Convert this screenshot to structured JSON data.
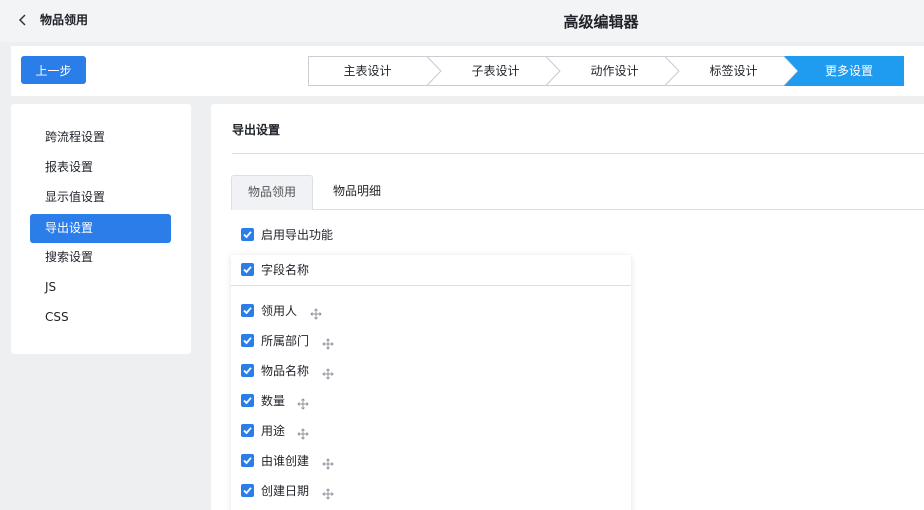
{
  "header": {
    "back_label": "物品领用",
    "title": "高级编辑器"
  },
  "toolbar": {
    "prev_label": "上一步",
    "steps": [
      {
        "label": "主表设计",
        "active": false
      },
      {
        "label": "子表设计",
        "active": false
      },
      {
        "label": "动作设计",
        "active": false
      },
      {
        "label": "标签设计",
        "active": false
      },
      {
        "label": "更多设置",
        "active": true
      }
    ]
  },
  "sidebar": {
    "items": [
      {
        "label": "跨流程设置",
        "active": false
      },
      {
        "label": "报表设置",
        "active": false
      },
      {
        "label": "显示值设置",
        "active": false
      },
      {
        "label": "导出设置",
        "active": true
      },
      {
        "label": "搜索设置",
        "active": false
      },
      {
        "label": "JS",
        "active": false
      },
      {
        "label": "CSS",
        "active": false
      }
    ]
  },
  "main": {
    "section_title": "导出设置",
    "tabs": [
      {
        "label": "物品领用",
        "active": true
      },
      {
        "label": "物品明细",
        "active": false
      }
    ],
    "enable_export": {
      "label": "启用导出功能",
      "checked": true
    },
    "field_header": {
      "label": "字段名称",
      "checked": true
    },
    "fields": [
      {
        "label": "领用人",
        "checked": true
      },
      {
        "label": "所属部门",
        "checked": true
      },
      {
        "label": "物品名称",
        "checked": true
      },
      {
        "label": "数量",
        "checked": true
      },
      {
        "label": "用途",
        "checked": true
      },
      {
        "label": "由谁创建",
        "checked": true
      },
      {
        "label": "创建日期",
        "checked": true
      }
    ]
  },
  "colors": {
    "accent": "#2b7de9",
    "step_active": "#1f9bf0",
    "step_border": "#c9cdd4"
  }
}
